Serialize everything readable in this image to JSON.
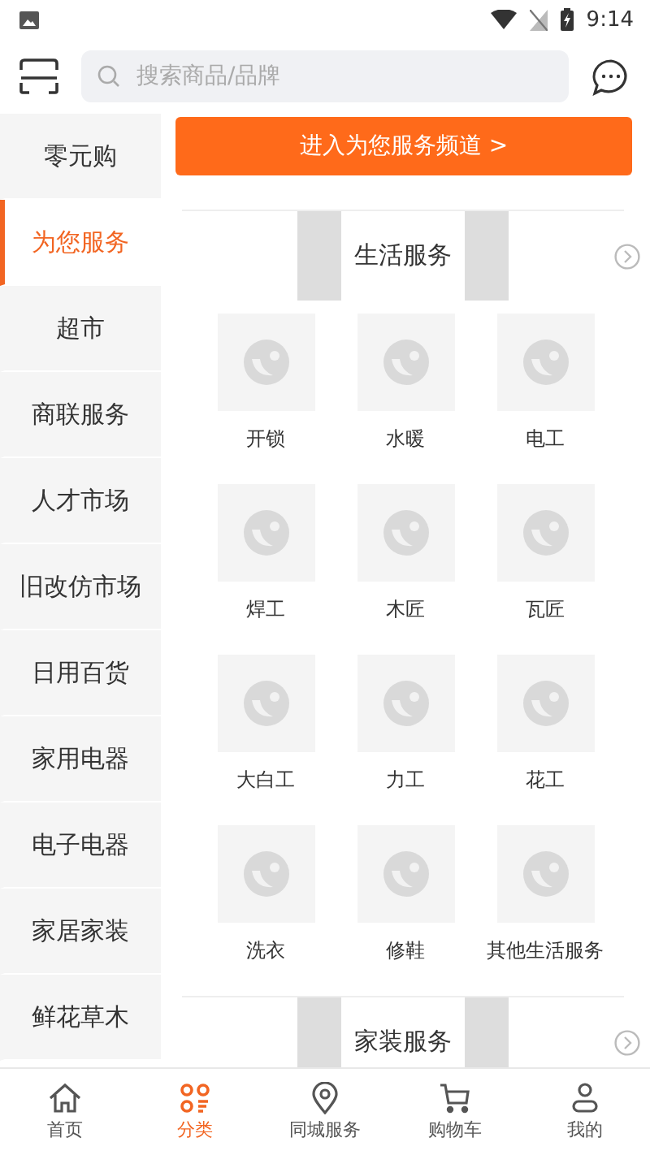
{
  "status_bar": {
    "time": "9:14"
  },
  "search": {
    "placeholder": "搜索商品/品牌"
  },
  "sidebar": {
    "items": [
      {
        "label": "零元购",
        "selected": false
      },
      {
        "label": "为您服务",
        "selected": true
      },
      {
        "label": "超市",
        "selected": false
      },
      {
        "label": "商联服务",
        "selected": false
      },
      {
        "label": "人才市场",
        "selected": false
      },
      {
        "label": "旧改仿市场",
        "selected": false
      },
      {
        "label": "日用百货",
        "selected": false
      },
      {
        "label": "家用电器",
        "selected": false
      },
      {
        "label": "电子电器",
        "selected": false
      },
      {
        "label": "家居家装",
        "selected": false
      },
      {
        "label": "鲜花草木",
        "selected": false
      }
    ]
  },
  "banner_button": {
    "label": "进入为您服务频道 >"
  },
  "sections": [
    {
      "title": "生活服务",
      "items": [
        {
          "label": "开锁"
        },
        {
          "label": "水暖"
        },
        {
          "label": "电工"
        },
        {
          "label": "焊工"
        },
        {
          "label": "木匠"
        },
        {
          "label": "瓦匠"
        },
        {
          "label": "大白工"
        },
        {
          "label": "力工"
        },
        {
          "label": "花工"
        },
        {
          "label": "洗衣"
        },
        {
          "label": "修鞋"
        },
        {
          "label": "其他生活服务"
        }
      ]
    },
    {
      "title": "家装服务"
    }
  ],
  "bottom_nav": [
    {
      "kind": "home",
      "label": "首页",
      "selected": false
    },
    {
      "kind": "category",
      "label": "分类",
      "selected": true
    },
    {
      "kind": "location",
      "label": "同城服务",
      "selected": false
    },
    {
      "kind": "cart",
      "label": "购物车",
      "selected": false
    },
    {
      "kind": "user",
      "label": "我的",
      "selected": false
    }
  ]
}
